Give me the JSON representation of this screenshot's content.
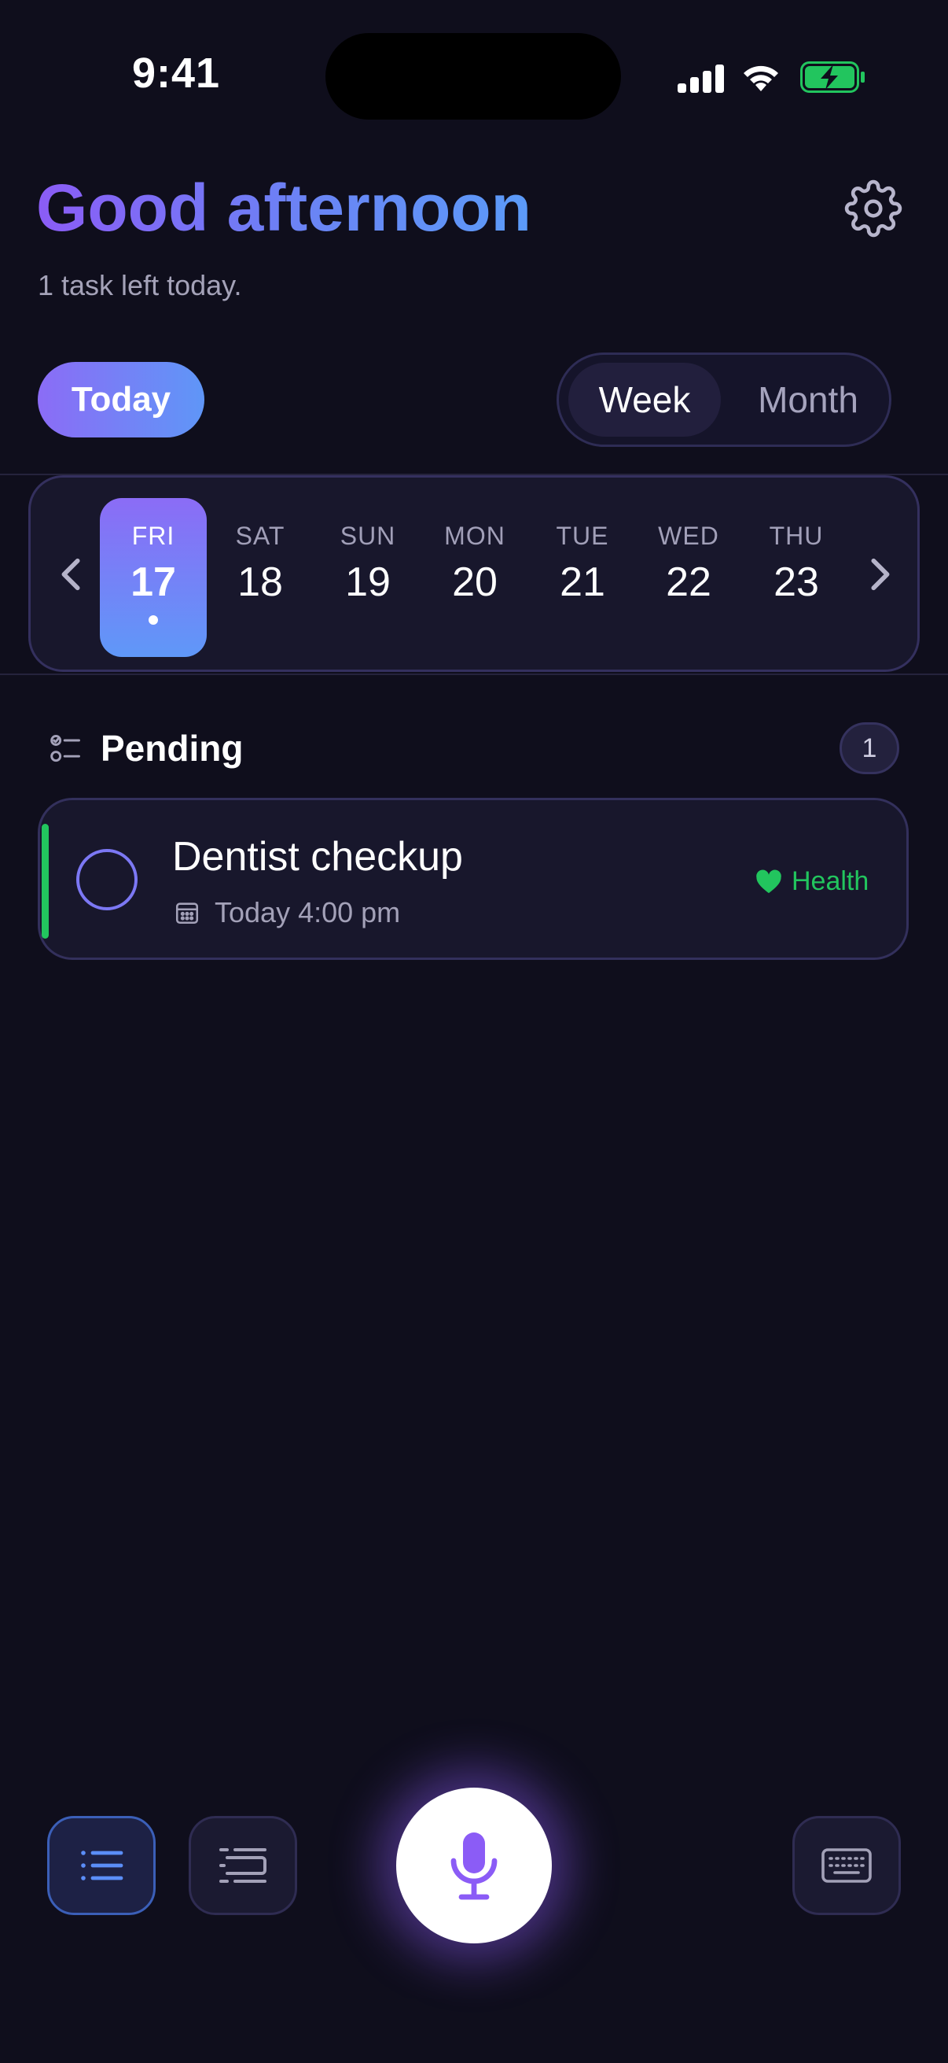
{
  "status_bar": {
    "time": "9:41"
  },
  "header": {
    "greeting": "Good afternoon",
    "subtitle": "1 task left today."
  },
  "controls": {
    "today_label": "Today",
    "view_options": [
      "Week",
      "Month"
    ],
    "selected_view": "Week"
  },
  "week": {
    "days": [
      {
        "name": "FRI",
        "num": "17",
        "selected": true,
        "has_task": true
      },
      {
        "name": "SAT",
        "num": "18"
      },
      {
        "name": "SUN",
        "num": "19"
      },
      {
        "name": "MON",
        "num": "20"
      },
      {
        "name": "TUE",
        "num": "21"
      },
      {
        "name": "WED",
        "num": "22"
      },
      {
        "name": "THU",
        "num": "23"
      }
    ]
  },
  "pending": {
    "label": "Pending",
    "count": "1",
    "tasks": [
      {
        "title": "Dentist checkup",
        "time": "Today 4:00 pm",
        "category": "Health",
        "category_color": "#22c55e",
        "category_icon": "heart-icon"
      }
    ]
  },
  "colors": {
    "background": "#0f0e1c",
    "accent_purple": "#8b5cf6",
    "accent_blue": "#5b9bf8",
    "health_green": "#22c55e"
  },
  "bottom_bar": {
    "buttons": [
      "list-view-icon",
      "timeline-view-icon",
      "microphone-icon",
      "keyboard-icon"
    ]
  }
}
